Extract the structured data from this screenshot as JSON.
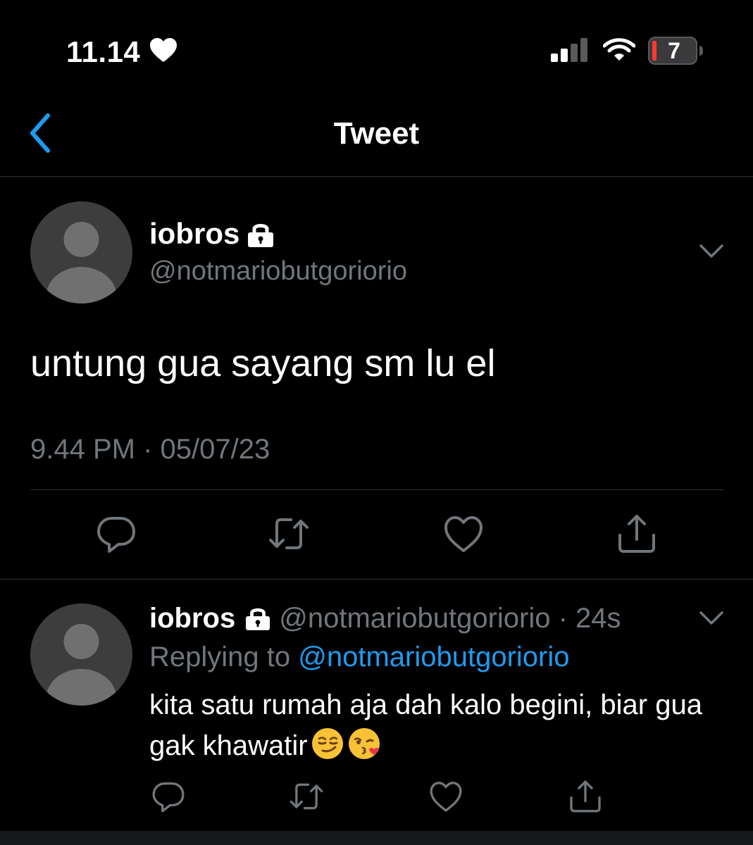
{
  "status_bar": {
    "time": "11.14",
    "battery_level": "7",
    "icons": [
      "heart-icon",
      "signal-icon",
      "wifi-icon",
      "battery-icon"
    ]
  },
  "header": {
    "title": "Tweet",
    "back_icon": "chevron-left-icon"
  },
  "main_tweet": {
    "display_name": "iobros",
    "handle": "@notmariobutgoriorio",
    "text": "untung gua sayang sm lu el",
    "timestamp": "9.44 PM · 05/07/23",
    "actions": [
      "reply-icon",
      "retweet-icon",
      "like-icon",
      "share-icon"
    ]
  },
  "reply_tweet": {
    "display_name": "iobros",
    "handle_time": "@notmariobutgoriorio · 24s",
    "replying_prefix": "Replying to ",
    "replying_handle": "@notmariobutgoriorio",
    "text": "kita satu rumah aja dah kalo begini, biar gua gak khawatir",
    "emojis": [
      "smirk-emoji",
      "kiss-emoji"
    ],
    "actions": [
      "reply-icon",
      "retweet-icon",
      "like-icon",
      "share-icon"
    ]
  },
  "colors": {
    "background": "#000000",
    "secondary_text": "#71767b",
    "link": "#1d9bf0",
    "divider": "#2f3336",
    "battery_low": "#ff3b30"
  }
}
